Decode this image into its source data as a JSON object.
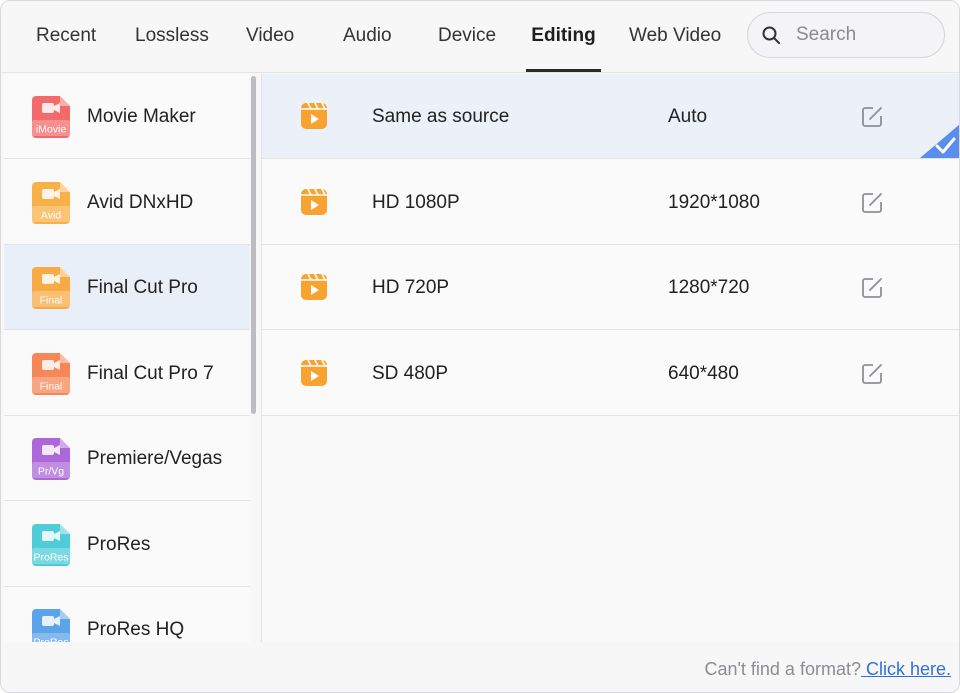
{
  "tabs": [
    {
      "label": "Recent"
    },
    {
      "label": "Lossless"
    },
    {
      "label": "Video"
    },
    {
      "label": "Audio"
    },
    {
      "label": "Device"
    },
    {
      "label": "Editing"
    },
    {
      "label": "Web Video"
    }
  ],
  "active_tab": "Editing",
  "search": {
    "placeholder": "Search",
    "value": ""
  },
  "sidebar": {
    "items": [
      {
        "label": "Movie Maker",
        "badge": "iMovie",
        "color": "#f25d5d"
      },
      {
        "label": "Avid DNxHD",
        "badge": "Avid",
        "color": "#f7a93a"
      },
      {
        "label": "Final Cut Pro",
        "badge": "Final",
        "color": "#f8a435"
      },
      {
        "label": "Final Cut Pro 7",
        "badge": "Final",
        "color": "#f57d4b"
      },
      {
        "label": "Premiere/Vegas",
        "badge": "Pr/Vg",
        "color": "#a55bd6"
      },
      {
        "label": "ProRes",
        "badge": "ProRes",
        "color": "#3fc9d6"
      },
      {
        "label": "ProRes HQ",
        "badge": "ProRes",
        "color": "#4f9be8"
      }
    ],
    "selected_index": 2
  },
  "formats": [
    {
      "name": "Same as source",
      "resolution": "Auto"
    },
    {
      "name": "HD 1080P",
      "resolution": "1920*1080"
    },
    {
      "name": "HD 720P",
      "resolution": "1280*720"
    },
    {
      "name": "SD 480P",
      "resolution": "640*480"
    }
  ],
  "selected_format_index": 0,
  "colors": {
    "accent": "#5b8def",
    "video_icon": "#f8a330",
    "link": "#2e6fe0"
  },
  "footer": {
    "question": "Can't find a format?",
    "link": " Click here."
  }
}
